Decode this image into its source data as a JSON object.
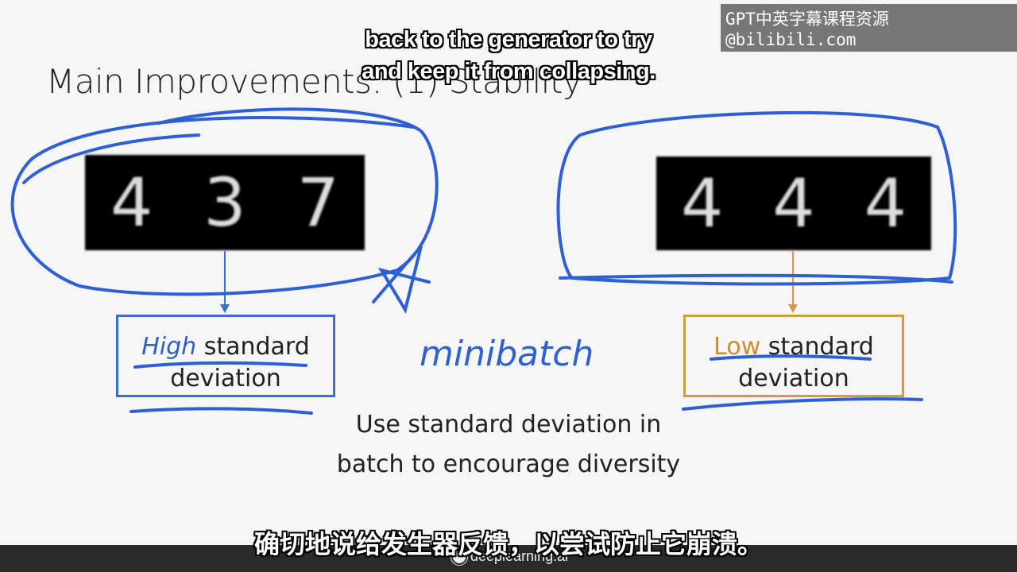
{
  "slide": {
    "title": "Main Improvements: (1) Stability",
    "left_digits": [
      "4",
      "3",
      "7"
    ],
    "right_digits": [
      "4",
      "4",
      "4"
    ],
    "left_box": {
      "highlight": "High",
      "rest": " standard",
      "line2": "deviation"
    },
    "right_box": {
      "highlight": "Low",
      "rest": " standard",
      "line2": "deviation"
    },
    "handwritten_note": "minibatch",
    "caption_line1": "Use standard deviation in",
    "caption_line2": "batch to encourage diversity"
  },
  "subtitles": {
    "english_line1": "back to the generator to try",
    "english_line2": "and keep it from collapsing.",
    "chinese": "确切地说给发生器反馈，以尝试防止它崩溃。"
  },
  "watermark": "GPT中英字幕课程资源@bilibili.com",
  "footer": {
    "brand": "deeplearning.ai"
  },
  "colors": {
    "annotation": "#2f5fd6",
    "high_box": "#3a6fd0",
    "low_box": "#d99845",
    "footer": "#2a2a2a"
  }
}
